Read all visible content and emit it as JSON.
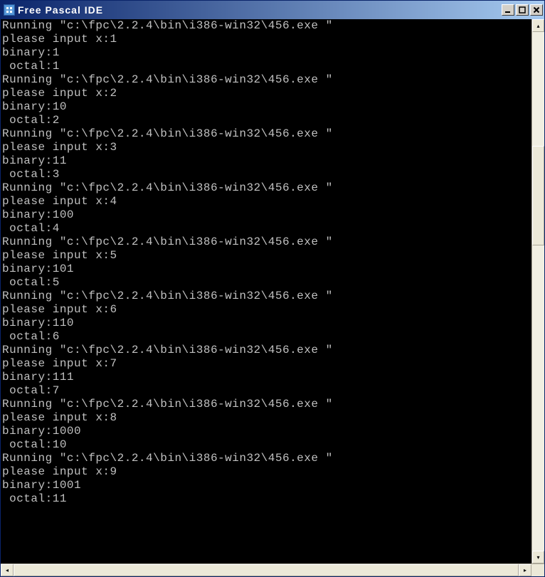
{
  "window": {
    "title": "Free Pascal IDE"
  },
  "titlebar_buttons": {
    "minimize": "_",
    "maximize": "□",
    "close": "×"
  },
  "console_lines": [
    "Running \"c:\\fpc\\2.2.4\\bin\\i386-win32\\456.exe \"",
    "please input x:1",
    "binary:1",
    " octal:1",
    "Running \"c:\\fpc\\2.2.4\\bin\\i386-win32\\456.exe \"",
    "please input x:2",
    "binary:10",
    " octal:2",
    "Running \"c:\\fpc\\2.2.4\\bin\\i386-win32\\456.exe \"",
    "please input x:3",
    "binary:11",
    " octal:3",
    "Running \"c:\\fpc\\2.2.4\\bin\\i386-win32\\456.exe \"",
    "please input x:4",
    "binary:100",
    " octal:4",
    "Running \"c:\\fpc\\2.2.4\\bin\\i386-win32\\456.exe \"",
    "please input x:5",
    "binary:101",
    " octal:5",
    "Running \"c:\\fpc\\2.2.4\\bin\\i386-win32\\456.exe \"",
    "please input x:6",
    "binary:110",
    " octal:6",
    "Running \"c:\\fpc\\2.2.4\\bin\\i386-win32\\456.exe \"",
    "please input x:7",
    "binary:111",
    " octal:7",
    "Running \"c:\\fpc\\2.2.4\\bin\\i386-win32\\456.exe \"",
    "please input x:8",
    "binary:1000",
    " octal:10",
    "Running \"c:\\fpc\\2.2.4\\bin\\i386-win32\\456.exe \"",
    "please input x:9",
    "binary:1001",
    " octal:11"
  ],
  "scrollbar": {
    "up_arrow": "▴",
    "down_arrow": "▾",
    "left_arrow": "◂",
    "right_arrow": "▸"
  }
}
